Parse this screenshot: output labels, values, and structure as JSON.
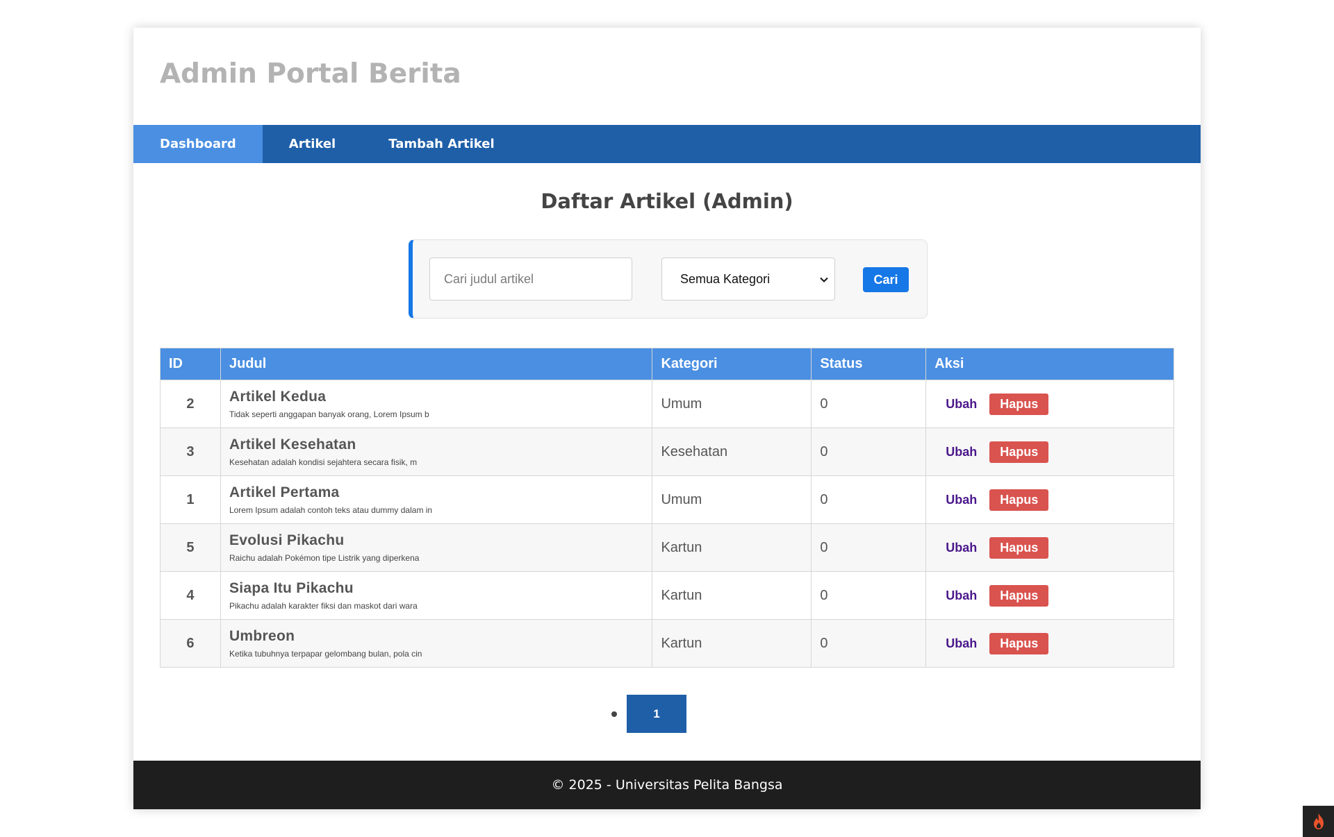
{
  "header": {
    "title": "Admin Portal Berita"
  },
  "nav": [
    {
      "label": "Dashboard",
      "active": true
    },
    {
      "label": "Artikel",
      "active": false
    },
    {
      "label": "Tambah Artikel",
      "active": false
    }
  ],
  "page": {
    "title": "Daftar Artikel (Admin)"
  },
  "search": {
    "placeholder": "Cari judul artikel",
    "value": "",
    "category_selected": "Semua Kategori",
    "button_label": "Cari"
  },
  "table": {
    "headers": [
      "ID",
      "Judul",
      "Kategori",
      "Status",
      "Aksi"
    ],
    "rows": [
      {
        "id": "2",
        "title": "Artikel Kedua",
        "excerpt": "Tidak seperti anggapan banyak orang, Lorem Ipsum b",
        "category": "Umum",
        "status": "0"
      },
      {
        "id": "3",
        "title": "Artikel Kesehatan",
        "excerpt": "Kesehatan adalah kondisi sejahtera secara fisik, m",
        "category": "Kesehatan",
        "status": "0"
      },
      {
        "id": "1",
        "title": "Artikel Pertama",
        "excerpt": "Lorem Ipsum adalah contoh teks atau dummy dalam in",
        "category": "Umum",
        "status": "0"
      },
      {
        "id": "5",
        "title": "Evolusi Pikachu",
        "excerpt": "Raichu adalah Pokémon tipe Listrik yang diperkena",
        "category": "Kartun",
        "status": "0"
      },
      {
        "id": "4",
        "title": "Siapa Itu Pikachu",
        "excerpt": "Pikachu adalah karakter fiksi dan maskot dari wara",
        "category": "Kartun",
        "status": "0"
      },
      {
        "id": "6",
        "title": "Umbreon",
        "excerpt": "Ketika tubuhnya terpapar gelombang bulan, pola cin",
        "category": "Kartun",
        "status": "0"
      }
    ],
    "action_edit": "Ubah",
    "action_delete": "Hapus"
  },
  "pagination": {
    "current_page": "1"
  },
  "footer": {
    "text": "© 2025 - Universitas Pelita Bangsa"
  },
  "colors": {
    "nav_bg": "#1e5fa8",
    "nav_active": "#4a8fe2",
    "table_header": "#4a8fe2",
    "primary_button": "#1677e6",
    "danger_button": "#d9534f",
    "edit_link": "#4a178b",
    "footer_bg": "#1e1e1e"
  },
  "icons": {
    "select_chevron": "chevron-down-icon",
    "corner_badge": "flame-icon"
  }
}
